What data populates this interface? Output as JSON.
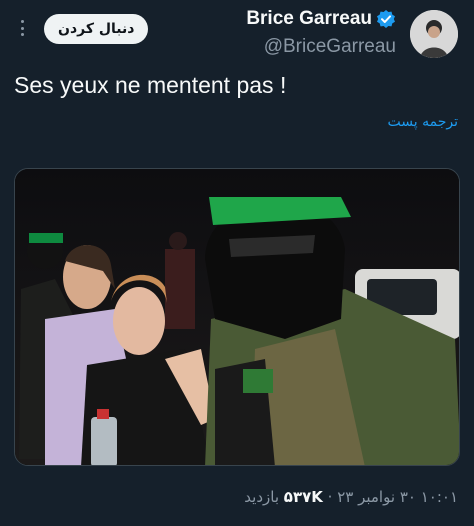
{
  "user": {
    "display_name": "Brice Garreau",
    "handle": "@BriceGarreau"
  },
  "actions": {
    "follow_label": "دنبال کردن"
  },
  "tweet": {
    "text": "Ses yeux ne mentent pas !",
    "translate_label": "ترجمه پست"
  },
  "meta": {
    "time": "۱۰:۰۱",
    "separator1": " ۳۰ ",
    "date": "نوامبر ۲۳",
    "separator2": " · ",
    "views_count": "۵۳۷K",
    "views_label": " بازدید"
  },
  "colors": {
    "background": "#15202b",
    "link": "#1d9bf0",
    "secondary_text": "#8b98a5",
    "verified": "#1d9bf0"
  },
  "icons": {
    "verified": "verified-badge-icon",
    "more": "more-vertical-icon"
  }
}
